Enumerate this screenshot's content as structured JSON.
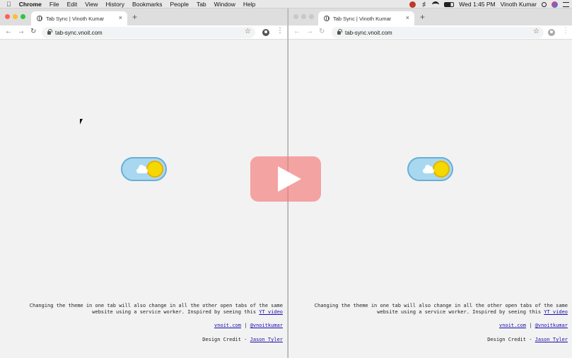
{
  "menubar": {
    "apple": "",
    "app_name": "Chrome",
    "items": [
      "File",
      "Edit",
      "View",
      "History",
      "Bookmarks",
      "People",
      "Tab",
      "Window",
      "Help"
    ],
    "clock": "Wed 1:45 PM",
    "user": "Vinoth Kumar"
  },
  "browser": {
    "tab_title": "Tab Sync | Vinoth Kumar",
    "url": "tab-sync.vnoit.com",
    "new_tab_symbol": "+",
    "close_symbol": "×"
  },
  "page": {
    "desc_line1": "Changing the theme in one tab will also change in all the other open tabs of the same",
    "desc_line2": "website using a service worker. Inspired by seeing this",
    "yt_link": "YT video",
    "site_link": "vnoit.com",
    "separator": "|",
    "handle_link": "@vnoitkumar",
    "credit_prefix": "Design Credit -",
    "credit_link": "Jason Tyler",
    "theme_state": "light"
  },
  "colors": {
    "toggle_bg": "#a8d8f0",
    "toggle_border": "#6aaed6",
    "sun": "#f5d800",
    "play_overlay": "#f47878",
    "link": "#1a0dab",
    "close_dot": "#fe5f57",
    "min_dot": "#febc2e",
    "max_dot": "#28c840"
  },
  "overlay": {
    "icon": "play-icon"
  }
}
